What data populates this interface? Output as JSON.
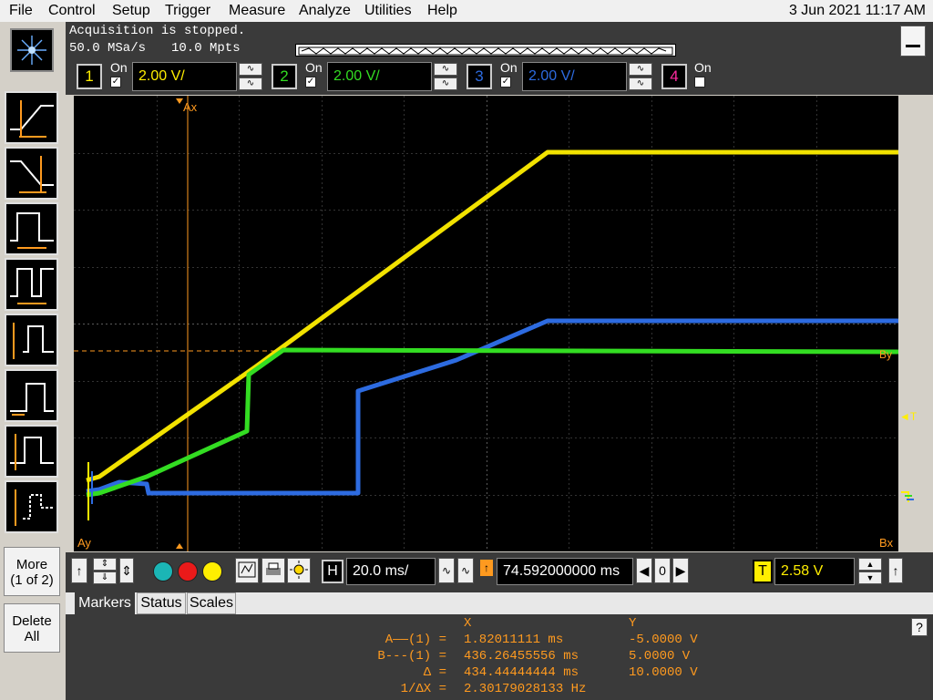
{
  "menu": {
    "items": [
      "File",
      "Control",
      "Setup",
      "Trigger",
      "Measure",
      "Analyze",
      "Utilities",
      "Help"
    ],
    "datetime": "3 Jun 2021 11:17 AM"
  },
  "status": {
    "line1": "Acquisition is stopped.",
    "sample_rate": "50.0 MSa/s",
    "memory_depth": "10.0 Mpts"
  },
  "channels": [
    {
      "number": "1",
      "on_label": "On",
      "checked": true,
      "scale": "2.00 V/",
      "color": "#ffee00"
    },
    {
      "number": "2",
      "on_label": "On",
      "checked": true,
      "scale": "2.00 V/",
      "color": "#33dd22"
    },
    {
      "number": "3",
      "on_label": "On",
      "checked": true,
      "scale": "2.00 V/",
      "color": "#2d6be0"
    },
    {
      "number": "4",
      "on_label": "On",
      "checked": false,
      "scale": "",
      "color": "#ff2aa0"
    }
  ],
  "graticule": {
    "marker_labels": {
      "ax": "Ax",
      "ay": "Ay",
      "bx": "Bx",
      "by": "By",
      "trigger": "T"
    }
  },
  "timebase": {
    "h_label": "H",
    "scale": "20.0 ms/",
    "position": "74.592000000 ms",
    "stepper_value": "0",
    "trigger_label": "T",
    "trigger_level": "2.58 V"
  },
  "side": {
    "more_line1": "More",
    "more_line2": "(1 of 2)",
    "delete_line1": "Delete",
    "delete_line2": "All"
  },
  "tabs": [
    "Markers",
    "Status",
    "Scales"
  ],
  "markers": {
    "header_x": "X",
    "header_y": "Y",
    "rows": [
      {
        "label": "A——(1) =",
        "x": "1.82011111 ms",
        "y": "-5.0000 V"
      },
      {
        "label": "B---(1) =",
        "x": "436.26455556 ms",
        "y": "5.0000 V"
      },
      {
        "label": "Δ =",
        "x": "434.44444444 ms",
        "y": "10.0000 V"
      },
      {
        "label": "1/ΔX =",
        "x": "2.30179028133 Hz",
        "y": ""
      }
    ]
  },
  "help_label": "?"
}
